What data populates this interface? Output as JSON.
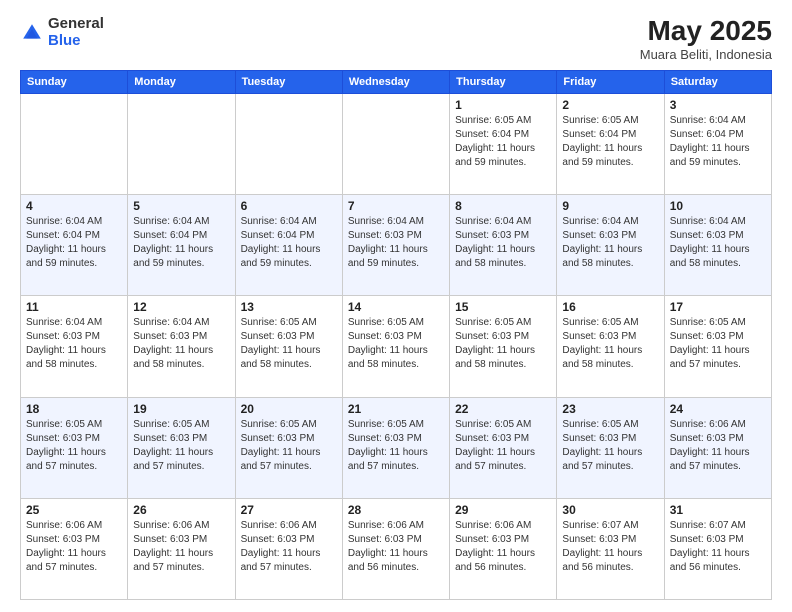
{
  "header": {
    "logo_general": "General",
    "logo_blue": "Blue",
    "month_year": "May 2025",
    "location": "Muara Beliti, Indonesia"
  },
  "weekdays": [
    "Sunday",
    "Monday",
    "Tuesday",
    "Wednesday",
    "Thursday",
    "Friday",
    "Saturday"
  ],
  "weeks": [
    [
      {
        "day": "",
        "info": ""
      },
      {
        "day": "",
        "info": ""
      },
      {
        "day": "",
        "info": ""
      },
      {
        "day": "",
        "info": ""
      },
      {
        "day": "1",
        "info": "Sunrise: 6:05 AM\nSunset: 6:04 PM\nDaylight: 11 hours\nand 59 minutes."
      },
      {
        "day": "2",
        "info": "Sunrise: 6:05 AM\nSunset: 6:04 PM\nDaylight: 11 hours\nand 59 minutes."
      },
      {
        "day": "3",
        "info": "Sunrise: 6:04 AM\nSunset: 6:04 PM\nDaylight: 11 hours\nand 59 minutes."
      }
    ],
    [
      {
        "day": "4",
        "info": "Sunrise: 6:04 AM\nSunset: 6:04 PM\nDaylight: 11 hours\nand 59 minutes."
      },
      {
        "day": "5",
        "info": "Sunrise: 6:04 AM\nSunset: 6:04 PM\nDaylight: 11 hours\nand 59 minutes."
      },
      {
        "day": "6",
        "info": "Sunrise: 6:04 AM\nSunset: 6:04 PM\nDaylight: 11 hours\nand 59 minutes."
      },
      {
        "day": "7",
        "info": "Sunrise: 6:04 AM\nSunset: 6:03 PM\nDaylight: 11 hours\nand 59 minutes."
      },
      {
        "day": "8",
        "info": "Sunrise: 6:04 AM\nSunset: 6:03 PM\nDaylight: 11 hours\nand 58 minutes."
      },
      {
        "day": "9",
        "info": "Sunrise: 6:04 AM\nSunset: 6:03 PM\nDaylight: 11 hours\nand 58 minutes."
      },
      {
        "day": "10",
        "info": "Sunrise: 6:04 AM\nSunset: 6:03 PM\nDaylight: 11 hours\nand 58 minutes."
      }
    ],
    [
      {
        "day": "11",
        "info": "Sunrise: 6:04 AM\nSunset: 6:03 PM\nDaylight: 11 hours\nand 58 minutes."
      },
      {
        "day": "12",
        "info": "Sunrise: 6:04 AM\nSunset: 6:03 PM\nDaylight: 11 hours\nand 58 minutes."
      },
      {
        "day": "13",
        "info": "Sunrise: 6:05 AM\nSunset: 6:03 PM\nDaylight: 11 hours\nand 58 minutes."
      },
      {
        "day": "14",
        "info": "Sunrise: 6:05 AM\nSunset: 6:03 PM\nDaylight: 11 hours\nand 58 minutes."
      },
      {
        "day": "15",
        "info": "Sunrise: 6:05 AM\nSunset: 6:03 PM\nDaylight: 11 hours\nand 58 minutes."
      },
      {
        "day": "16",
        "info": "Sunrise: 6:05 AM\nSunset: 6:03 PM\nDaylight: 11 hours\nand 58 minutes."
      },
      {
        "day": "17",
        "info": "Sunrise: 6:05 AM\nSunset: 6:03 PM\nDaylight: 11 hours\nand 57 minutes."
      }
    ],
    [
      {
        "day": "18",
        "info": "Sunrise: 6:05 AM\nSunset: 6:03 PM\nDaylight: 11 hours\nand 57 minutes."
      },
      {
        "day": "19",
        "info": "Sunrise: 6:05 AM\nSunset: 6:03 PM\nDaylight: 11 hours\nand 57 minutes."
      },
      {
        "day": "20",
        "info": "Sunrise: 6:05 AM\nSunset: 6:03 PM\nDaylight: 11 hours\nand 57 minutes."
      },
      {
        "day": "21",
        "info": "Sunrise: 6:05 AM\nSunset: 6:03 PM\nDaylight: 11 hours\nand 57 minutes."
      },
      {
        "day": "22",
        "info": "Sunrise: 6:05 AM\nSunset: 6:03 PM\nDaylight: 11 hours\nand 57 minutes."
      },
      {
        "day": "23",
        "info": "Sunrise: 6:05 AM\nSunset: 6:03 PM\nDaylight: 11 hours\nand 57 minutes."
      },
      {
        "day": "24",
        "info": "Sunrise: 6:06 AM\nSunset: 6:03 PM\nDaylight: 11 hours\nand 57 minutes."
      }
    ],
    [
      {
        "day": "25",
        "info": "Sunrise: 6:06 AM\nSunset: 6:03 PM\nDaylight: 11 hours\nand 57 minutes."
      },
      {
        "day": "26",
        "info": "Sunrise: 6:06 AM\nSunset: 6:03 PM\nDaylight: 11 hours\nand 57 minutes."
      },
      {
        "day": "27",
        "info": "Sunrise: 6:06 AM\nSunset: 6:03 PM\nDaylight: 11 hours\nand 57 minutes."
      },
      {
        "day": "28",
        "info": "Sunrise: 6:06 AM\nSunset: 6:03 PM\nDaylight: 11 hours\nand 56 minutes."
      },
      {
        "day": "29",
        "info": "Sunrise: 6:06 AM\nSunset: 6:03 PM\nDaylight: 11 hours\nand 56 minutes."
      },
      {
        "day": "30",
        "info": "Sunrise: 6:07 AM\nSunset: 6:03 PM\nDaylight: 11 hours\nand 56 minutes."
      },
      {
        "day": "31",
        "info": "Sunrise: 6:07 AM\nSunset: 6:03 PM\nDaylight: 11 hours\nand 56 minutes."
      }
    ]
  ]
}
